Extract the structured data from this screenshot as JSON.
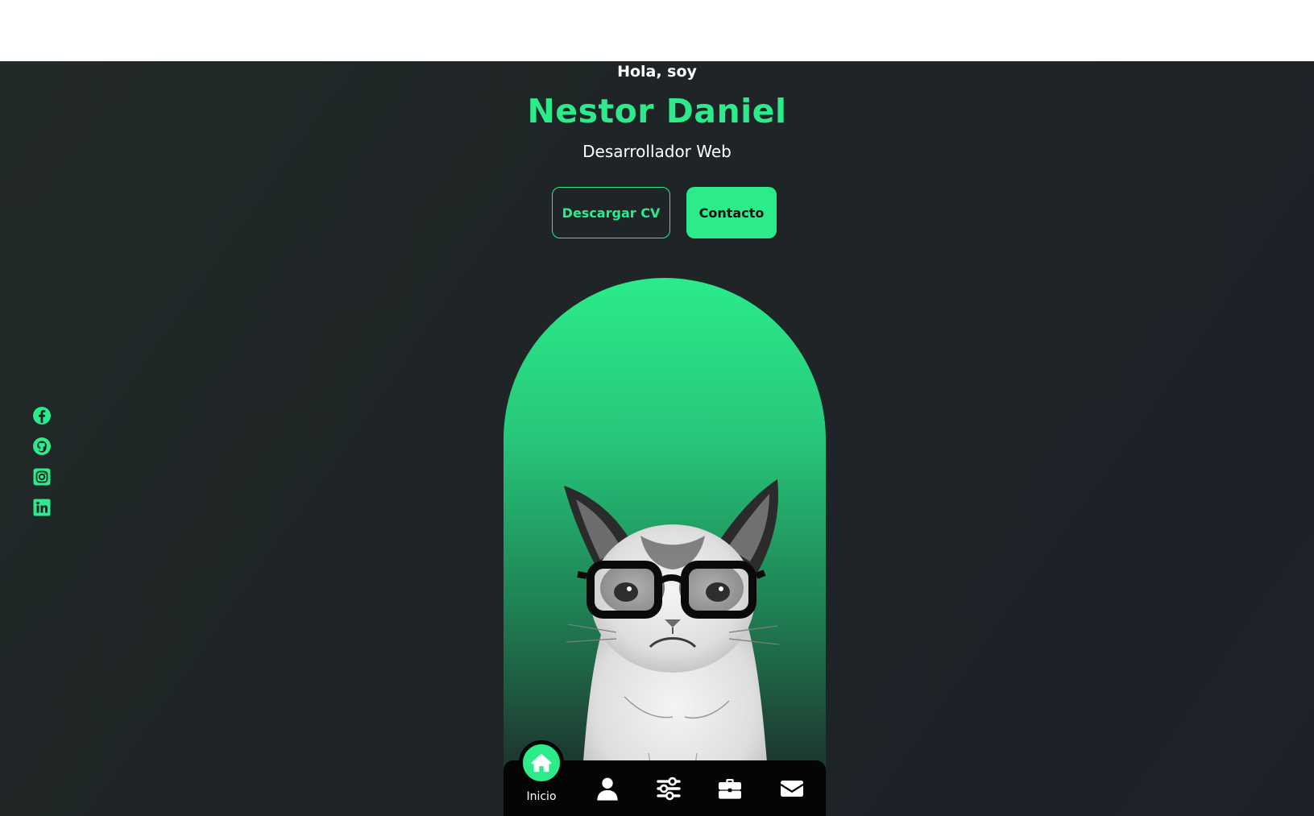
{
  "hero": {
    "greeting": "Hola, soy",
    "name": "Nestor Daniel",
    "role": "Desarrollador Web",
    "buttons": {
      "download_cv": "Descargar CV",
      "contact": "Contacto"
    }
  },
  "socials": [
    {
      "icon": "facebook-icon"
    },
    {
      "icon": "github-icon"
    },
    {
      "icon": "instagram-icon"
    },
    {
      "icon": "linkedin-icon"
    }
  ],
  "bottom_nav": {
    "active": "Inicio",
    "items": [
      {
        "icon": "home-icon",
        "label": "Inicio"
      },
      {
        "icon": "user-icon"
      },
      {
        "icon": "sliders-icon"
      },
      {
        "icon": "briefcase-icon"
      },
      {
        "icon": "envelope-icon"
      }
    ]
  },
  "colors": {
    "accent": "#2beb8b",
    "background": "#1e2129",
    "nav_background": "#050505",
    "text": "#ffffff"
  }
}
